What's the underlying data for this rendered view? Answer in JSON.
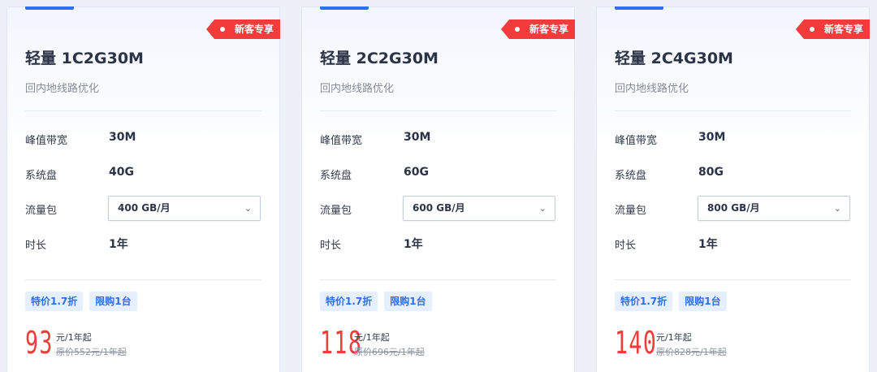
{
  "cards": [
    {
      "tag": "新客专享",
      "title": "轻量 1C2G30M",
      "subtitle": "回内地线路优化",
      "rows": [
        {
          "label": "峰值带宽",
          "value": "30M"
        },
        {
          "label": "系统盘",
          "value": "40G"
        },
        {
          "label": "流量包",
          "value": "400 GB/月"
        },
        {
          "label": "时长",
          "value": "1年"
        }
      ],
      "badges": [
        "特价1.7折",
        "限购1台"
      ],
      "price": "93",
      "unit": "元/1年起",
      "original": "原价552元/1年起"
    },
    {
      "tag": "新客专享",
      "title": "轻量 2C2G30M",
      "subtitle": "回内地线路优化",
      "rows": [
        {
          "label": "峰值带宽",
          "value": "30M"
        },
        {
          "label": "系统盘",
          "value": "60G"
        },
        {
          "label": "流量包",
          "value": "600 GB/月"
        },
        {
          "label": "时长",
          "value": "1年"
        }
      ],
      "badges": [
        "特价1.7折",
        "限购1台"
      ],
      "price": "118",
      "unit": "元/1年起",
      "original": "原价696元/1年起"
    },
    {
      "tag": "新客专享",
      "title": "轻量 2C4G30M",
      "subtitle": "回内地线路优化",
      "rows": [
        {
          "label": "峰值带宽",
          "value": "30M"
        },
        {
          "label": "系统盘",
          "value": "80G"
        },
        {
          "label": "流量包",
          "value": "800 GB/月"
        },
        {
          "label": "时长",
          "value": "1年"
        }
      ],
      "badges": [
        "特价1.7折",
        "限购1台"
      ],
      "price": "140",
      "unit": "元/1年起",
      "original": "原价828元/1年起"
    }
  ],
  "icons": {
    "dropdown": "chevron-down-icon",
    "tag_dot": "dot-icon"
  },
  "colors": {
    "accent": "#2a6ff4",
    "price": "#f23b3b",
    "tag": "#f23b3b",
    "badge_bg": "#e5efff"
  }
}
